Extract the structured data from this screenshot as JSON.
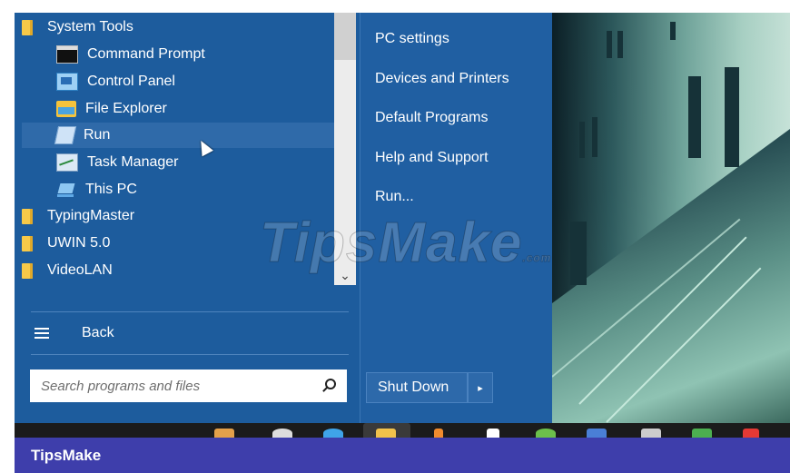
{
  "programs": {
    "items": [
      {
        "label": "System Tools",
        "icon": "folder-icon",
        "kind": "folder"
      },
      {
        "label": "Command Prompt",
        "icon": "command-prompt-icon",
        "kind": "child"
      },
      {
        "label": "Control Panel",
        "icon": "control-panel-icon",
        "kind": "child"
      },
      {
        "label": "File Explorer",
        "icon": "file-explorer-icon",
        "kind": "child"
      },
      {
        "label": "Run",
        "icon": "run-icon",
        "kind": "child",
        "hovered": true
      },
      {
        "label": "Task Manager",
        "icon": "task-manager-icon",
        "kind": "child"
      },
      {
        "label": "This PC",
        "icon": "this-pc-icon",
        "kind": "child"
      },
      {
        "label": "TypingMaster",
        "icon": "folder-icon",
        "kind": "folder"
      },
      {
        "label": "UWIN 5.0",
        "icon": "folder-icon",
        "kind": "folder"
      },
      {
        "label": "VideoLAN",
        "icon": "folder-icon",
        "kind": "folder"
      }
    ],
    "back_label": "Back"
  },
  "search": {
    "placeholder": "Search programs and files",
    "value": ""
  },
  "links": {
    "items": [
      "PC settings",
      "Devices and Printers",
      "Default Programs",
      "Help and Support",
      "Run..."
    ],
    "shutdown_label": "Shut Down"
  },
  "watermark": {
    "text": "TipsMake",
    "sub": ".com"
  },
  "brand": {
    "text": "TipsMake"
  },
  "colors": {
    "menu_bg": "#1d5c9d",
    "hover": "#2f6aa9",
    "brand_bar": "#3e3eab",
    "folder": "#f7c948"
  }
}
